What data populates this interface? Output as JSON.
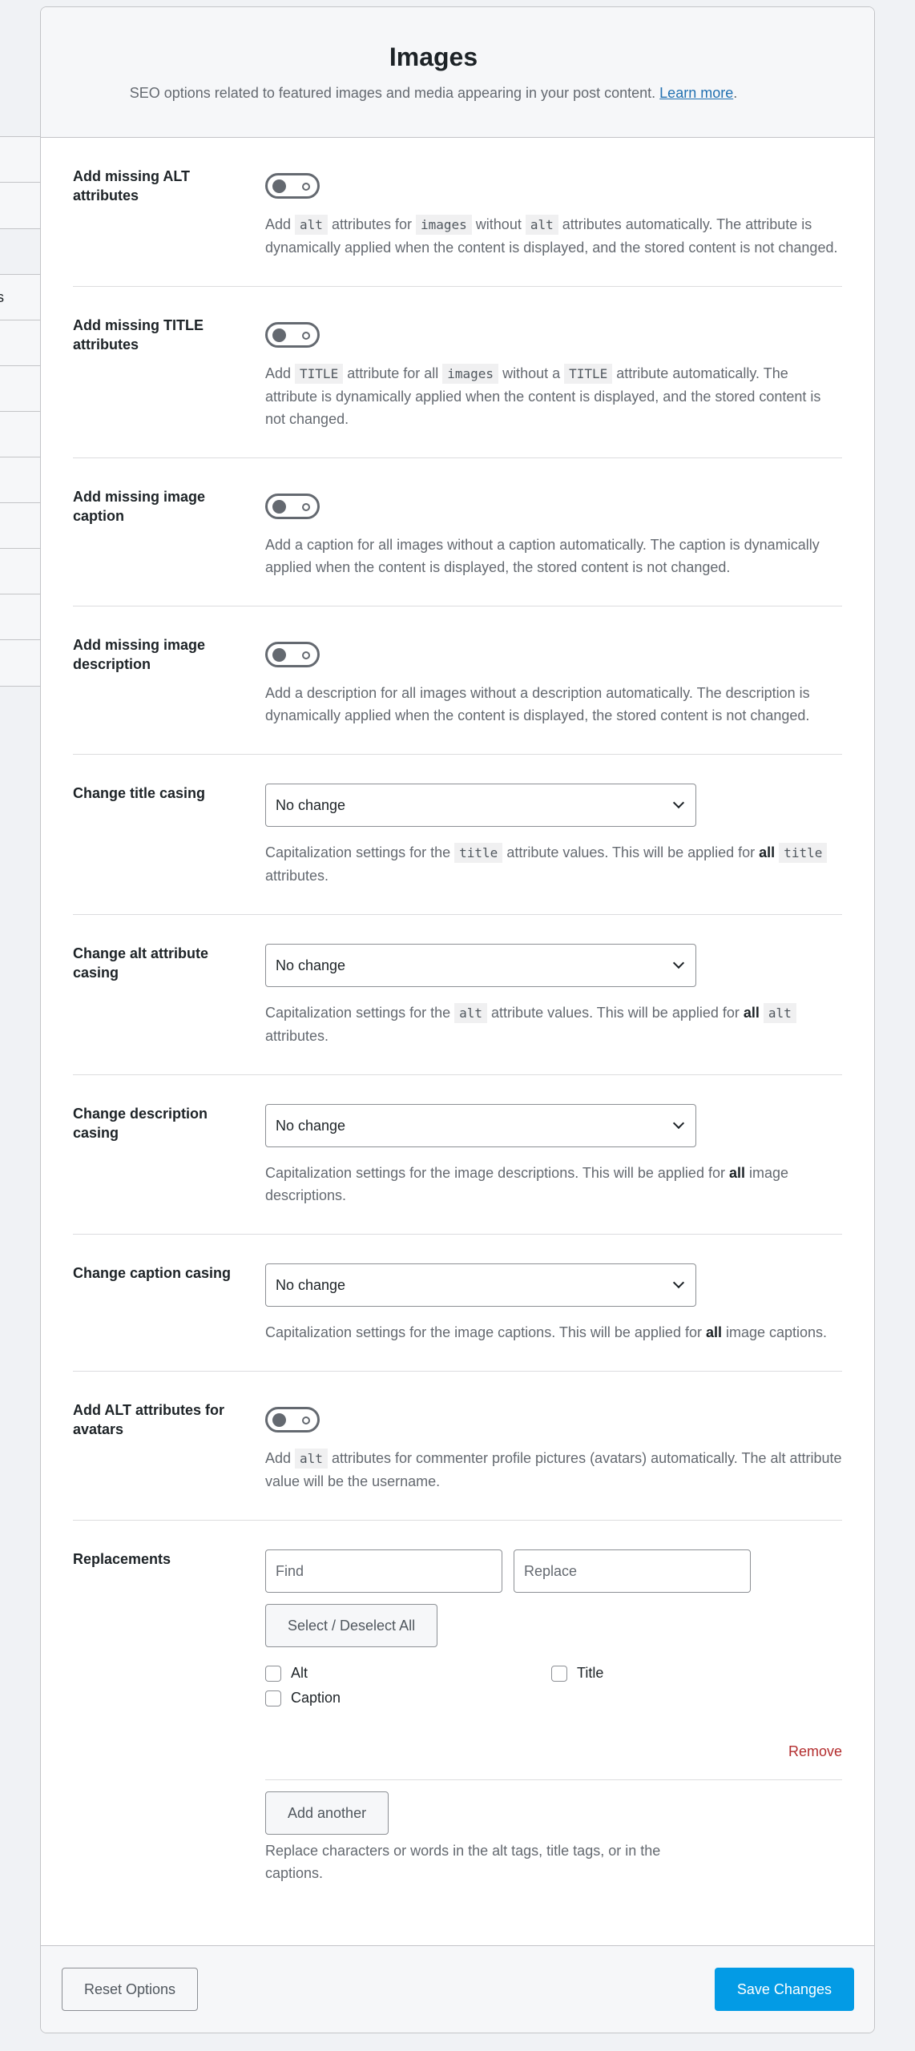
{
  "header": {
    "title": "Images",
    "subtitle": "SEO options related to featured images and media appearing in your post content.",
    "learn_more": "Learn more",
    "period": "."
  },
  "sidebar_fragments": {
    "group1": [
      "",
      ""
    ],
    "group2": [
      "s",
      "",
      "",
      "",
      "",
      "",
      "",
      "",
      ""
    ]
  },
  "settings": {
    "missing_alt": {
      "label": "Add missing ALT attributes",
      "enabled": false,
      "desc": [
        "Add ",
        "alt",
        " attributes for ",
        "images",
        " without ",
        "alt",
        " attributes automatically. The attribute is dynamically applied when the content is displayed, and the stored content is not changed."
      ]
    },
    "missing_title": {
      "label": "Add missing TITLE attributes",
      "enabled": false,
      "desc": [
        "Add ",
        "TITLE",
        " attribute for all ",
        "images",
        " without a ",
        "TITLE",
        " attribute automatically. The attribute is dynamically applied when the content is displayed, and the stored content is not changed."
      ]
    },
    "missing_caption": {
      "label": "Add missing image caption",
      "enabled": false,
      "desc": "Add a caption for all images without a caption automatically. The caption is dynamically applied when the content is displayed, the stored content is not changed."
    },
    "missing_description": {
      "label": "Add missing image description",
      "enabled": false,
      "desc": "Add a description for all images without a description automatically. The description is dynamically applied when the content is displayed, the stored content is not changed."
    },
    "title_casing": {
      "label": "Change title casing",
      "value": "No change",
      "desc": [
        "Capitalization settings for the ",
        "title",
        " attribute values. This will be applied for ",
        "all",
        " ",
        "title",
        " attributes."
      ]
    },
    "alt_casing": {
      "label": "Change alt attribute casing",
      "value": "No change",
      "desc": [
        "Capitalization settings for the ",
        "alt",
        " attribute values. This will be applied for ",
        "all",
        " ",
        "alt",
        " attributes."
      ]
    },
    "description_casing": {
      "label": "Change description casing",
      "value": "No change",
      "desc": [
        "Capitalization settings for the image descriptions. This will be applied for ",
        "all",
        " image descriptions."
      ]
    },
    "caption_casing": {
      "label": "Change caption casing",
      "value": "No change",
      "desc": [
        "Capitalization settings for the image captions. This will be applied for ",
        "all",
        " image captions."
      ]
    },
    "avatar_alt": {
      "label": "Add ALT attributes for avatars",
      "enabled": false,
      "desc": [
        "Add ",
        "alt",
        " attributes for commenter profile pictures (avatars) automatically. The alt attribute value will be the username."
      ]
    },
    "replacements": {
      "label": "Replacements",
      "find_placeholder": "Find",
      "replace_placeholder": "Replace",
      "find_value": "",
      "replace_value": "",
      "select_all_label": "Select / Deselect All",
      "checkboxes": [
        {
          "label": "Alt",
          "checked": false
        },
        {
          "label": "Title",
          "checked": false
        },
        {
          "label": "Caption",
          "checked": false
        }
      ],
      "remove_label": "Remove",
      "add_another_label": "Add another",
      "desc": "Replace characters or words in the alt tags, title tags, or in the captions."
    }
  },
  "footer": {
    "reset_label": "Reset Options",
    "save_label": "Save Changes"
  },
  "colors": {
    "primary": "#039be5",
    "danger": "#b32d2e",
    "link": "#2271b1"
  }
}
